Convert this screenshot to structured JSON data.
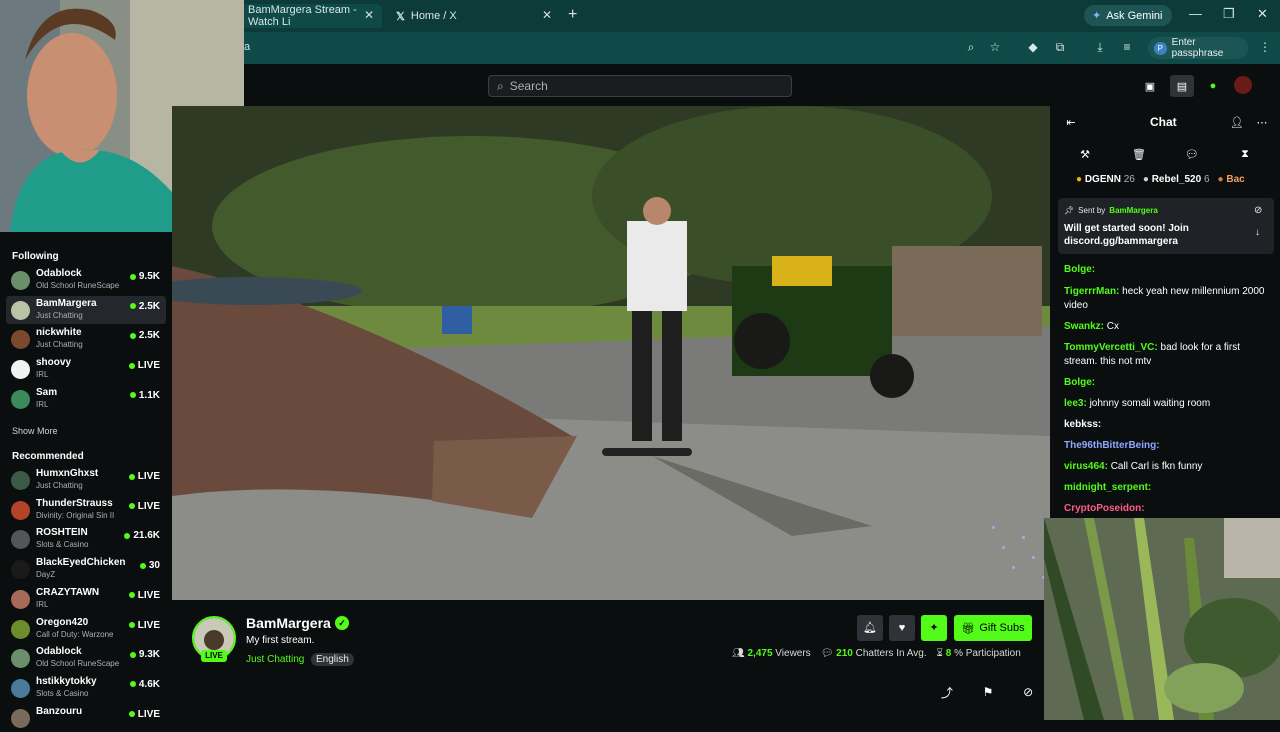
{
  "browser": {
    "tabs": [
      {
        "label": "BamMargera Stream - Watch Li"
      },
      {
        "label": "Home / X"
      }
    ],
    "gemini_label": "Ask Gemini",
    "url": "a",
    "passphrase_label": "Enter passphrase",
    "passphrase_initial": "P"
  },
  "header": {
    "search_placeholder": "Search"
  },
  "sidebar": {
    "following_title": "Following",
    "following": [
      {
        "name": "Odablock",
        "category": "Old School RuneScape",
        "count": "9.5K",
        "color": "#6b8e6b"
      },
      {
        "name": "BamMargera",
        "category": "Just Chatting",
        "count": "2.5K",
        "color": "#b9c4a6"
      },
      {
        "name": "nickwhite",
        "category": "Just Chatting",
        "count": "2.5K",
        "color": "#7b4a2e"
      },
      {
        "name": "shoovy",
        "category": "IRL",
        "count": "LIVE",
        "color": "#f2f2f2"
      },
      {
        "name": "Sam",
        "category": "IRL",
        "count": "1.1K",
        "color": "#3a8a5a"
      }
    ],
    "show_more": "Show More",
    "recommended_title": "Recommended",
    "recommended": [
      {
        "name": "HumxnGhxst",
        "category": "Just Chatting",
        "count": "LIVE",
        "color": "#3b5a45"
      },
      {
        "name": "ThunderStrauss",
        "category": "Divinity: Original Sin II",
        "count": "LIVE",
        "color": "#b2442a"
      },
      {
        "name": "ROSHTEIN",
        "category": "Slots & Casino",
        "count": "21.6K",
        "color": "#52555a"
      },
      {
        "name": "BlackEyedChicken",
        "category": "DayZ",
        "count": "30",
        "color": "#1a1a1a"
      },
      {
        "name": "CRAZYTAWN",
        "category": "IRL",
        "count": "LIVE",
        "color": "#a86a58"
      },
      {
        "name": "Oregon420",
        "category": "Call of Duty: Warzone",
        "count": "LIVE",
        "color": "#6b8e2a"
      },
      {
        "name": "Odablock",
        "category": "Old School RuneScape",
        "count": "9.3K",
        "color": "#6b8e6b"
      },
      {
        "name": "hstikkytokky",
        "category": "Slots & Casino",
        "count": "4.6K",
        "color": "#4a7a9a"
      },
      {
        "name": "Banzouru",
        "category": "",
        "count": "LIVE",
        "color": "#7a6a5a"
      }
    ]
  },
  "stream": {
    "channel": "BamMargera",
    "title": "My first stream.",
    "category": "Just Chatting",
    "language": "English",
    "live_badge": "LIVE",
    "gift_label": "Gift Subs",
    "viewers": "2,475",
    "viewers_label": "Viewers",
    "chatters": "210",
    "chatters_label": "Chatters In Avg.",
    "participation": "8",
    "participation_label": "% Participation"
  },
  "chat": {
    "title": "Chat",
    "leaders": [
      {
        "name": "DGENN",
        "count": "26"
      },
      {
        "name": "Rebel_520",
        "count": "6"
      },
      {
        "name": "Bac",
        "count": ""
      }
    ],
    "pinned": {
      "sent_by": "Sent by",
      "author": "BamMargera",
      "text": "Will get started soon! Join discord.gg/bammargera"
    },
    "messages": [
      {
        "user": "Bolge:",
        "text": "",
        "color": "#53fc18"
      },
      {
        "user": "TigerrrMan:",
        "text": "heck yeah new millennium 2000 video",
        "color": "#53fc18"
      },
      {
        "user": "Swankz:",
        "text": "Cx",
        "color": "#53fc18"
      },
      {
        "user": "TommyVercetti_VC:",
        "text": "bad look for a first stream. this not mtv",
        "color": "#53fc18"
      },
      {
        "user": "Bolge:",
        "text": "",
        "color": "#53fc18"
      },
      {
        "user": "lee3:",
        "text": "johnny somali waiting room",
        "color": "#53fc18"
      },
      {
        "user": "kebkss:",
        "text": "",
        "color": "#ffffff"
      },
      {
        "user": "The96thBitterBeing:",
        "text": "",
        "color": "#8fa8ff"
      },
      {
        "user": "virus464:",
        "text": "Call Carl is fkn funny",
        "color": "#53fc18"
      },
      {
        "user": "midnight_serpent:",
        "text": "",
        "color": "#53fc18"
      },
      {
        "user": "CryptoPoseidon:",
        "text": "",
        "color": "#ff5c8a"
      }
    ]
  }
}
